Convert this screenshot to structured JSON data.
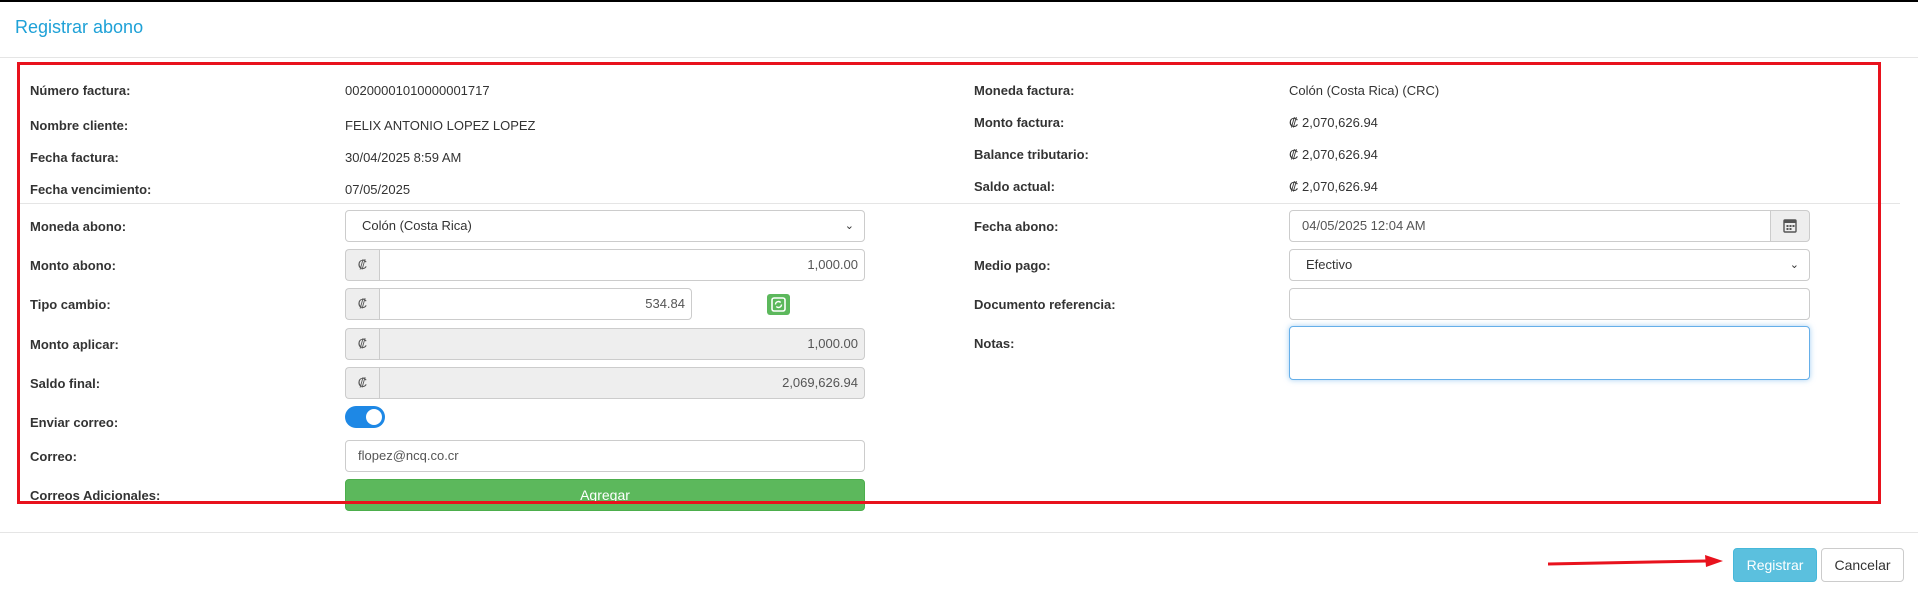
{
  "modal": {
    "title": "Registrar abono"
  },
  "invoice": {
    "numero_label": "Número factura:",
    "numero_value": "00200001010000001717",
    "cliente_label": "Nombre cliente:",
    "cliente_value": "FELIX ANTONIO LOPEZ LOPEZ",
    "fecha_label": "Fecha factura:",
    "fecha_value": "30/04/2025 8:59 AM",
    "vencimiento_label": "Fecha vencimiento:",
    "vencimiento_value": "07/05/2025",
    "moneda_label": "Moneda factura:",
    "moneda_value": "Colón (Costa Rica) (CRC)",
    "monto_label": "Monto factura:",
    "monto_value": "₡ 2,070,626.94",
    "balance_label": "Balance tributario:",
    "balance_value": "₡ 2,070,626.94",
    "saldo_label": "Saldo actual:",
    "saldo_value": "₡ 2,070,626.94"
  },
  "form": {
    "moneda_abono": {
      "label": "Moneda abono:",
      "value": "Colón (Costa Rica)"
    },
    "monto_abono": {
      "label": "Monto abono:",
      "symbol": "₡",
      "value": "1,000.00"
    },
    "tipo_cambio": {
      "label": "Tipo cambio:",
      "symbol": "₡",
      "value": "534.84"
    },
    "monto_aplicar": {
      "label": "Monto aplicar:",
      "symbol": "₡",
      "value": "1,000.00"
    },
    "saldo_final": {
      "label": "Saldo final:",
      "symbol": "₡",
      "value": "2,069,626.94"
    },
    "enviar_correo": {
      "label": "Enviar correo:",
      "checked": true
    },
    "correo": {
      "label": "Correo:",
      "value": "flopez@ncq.co.cr"
    },
    "correos_adicionales": {
      "label": "Correos Adicionales:",
      "button": "Agregar"
    },
    "fecha_abono": {
      "label": "Fecha abono:",
      "value": "04/05/2025 12:04 AM"
    },
    "medio_pago": {
      "label": "Medio pago:",
      "value": "Efectivo"
    },
    "documento_referencia": {
      "label": "Documento referencia:",
      "value": ""
    },
    "notas": {
      "label": "Notas:",
      "value": ""
    }
  },
  "footer": {
    "submit_label": "Registrar",
    "cancel_label": "Cancelar"
  },
  "colors": {
    "title": "#1ea1d7",
    "highlight": "#e8121d",
    "primary": "#5bc0de",
    "success": "#5cb85c",
    "toggle": "#1e88e5"
  }
}
